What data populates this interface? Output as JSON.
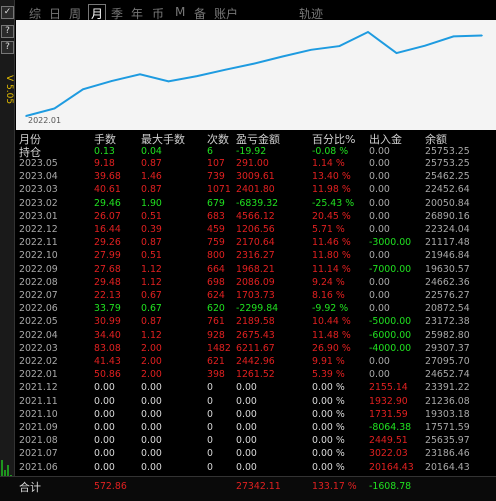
{
  "left_bar": {
    "buttons": [
      "✓",
      "?",
      "?"
    ],
    "version": "V 5.05"
  },
  "tabs": [
    "综",
    "日",
    "周",
    "月",
    "季",
    "年",
    "币",
    "M",
    "备",
    "账户",
    "轨迹"
  ],
  "active_tab": "月",
  "chart": {
    "x_label": "2022.01"
  },
  "headers": [
    "月份",
    "手数",
    "最大手数",
    "次数",
    "盈亏金额",
    "百分比%",
    "出入金",
    "余额"
  ],
  "hold": {
    "label": "持仓",
    "lots": "0.13",
    "max": "0.04",
    "count": "6",
    "pnl": "-19.92",
    "pct": "-0.08 %",
    "io": "0.00",
    "bal": "25753.25"
  },
  "rows": [
    {
      "month": "2023.05",
      "lots": "9.18",
      "max": "0.87",
      "count": "107",
      "pnl": "291.00",
      "pct": "1.14 %",
      "io": "0.00",
      "bal": "25753.25",
      "c": "red"
    },
    {
      "month": "2023.04",
      "lots": "39.68",
      "max": "1.46",
      "count": "739",
      "pnl": "3009.61",
      "pct": "13.40 %",
      "io": "0.00",
      "bal": "25462.25",
      "c": "red"
    },
    {
      "month": "2023.03",
      "lots": "40.61",
      "max": "0.87",
      "count": "1071",
      "pnl": "2401.80",
      "pct": "11.98 %",
      "io": "0.00",
      "bal": "22452.64",
      "c": "red"
    },
    {
      "month": "2023.02",
      "lots": "29.46",
      "max": "1.90",
      "count": "679",
      "pnl": "-6839.32",
      "pct": "-25.43 %",
      "io": "0.00",
      "bal": "20050.84",
      "c": "green"
    },
    {
      "month": "2023.01",
      "lots": "26.07",
      "max": "0.51",
      "count": "683",
      "pnl": "4566.12",
      "pct": "20.45 %",
      "io": "0.00",
      "bal": "26890.16",
      "c": "red"
    },
    {
      "month": "2022.12",
      "lots": "16.44",
      "max": "0.39",
      "count": "459",
      "pnl": "1206.56",
      "pct": "5.71 %",
      "io": "0.00",
      "bal": "22324.04",
      "c": "red"
    },
    {
      "month": "2022.11",
      "lots": "29.26",
      "max": "0.87",
      "count": "759",
      "pnl": "2170.64",
      "pct": "11.46 %",
      "io": "-3000.00",
      "bal": "21117.48",
      "c": "red"
    },
    {
      "month": "2022.10",
      "lots": "27.99",
      "max": "0.51",
      "count": "800",
      "pnl": "2316.27",
      "pct": "11.80 %",
      "io": "0.00",
      "bal": "21946.84",
      "c": "red"
    },
    {
      "month": "2022.09",
      "lots": "27.68",
      "max": "1.12",
      "count": "664",
      "pnl": "1968.21",
      "pct": "11.14 %",
      "io": "-7000.00",
      "bal": "19630.57",
      "c": "red"
    },
    {
      "month": "2022.08",
      "lots": "29.48",
      "max": "1.12",
      "count": "698",
      "pnl": "2086.09",
      "pct": "9.24 %",
      "io": "0.00",
      "bal": "24662.36",
      "c": "red"
    },
    {
      "month": "2022.07",
      "lots": "22.13",
      "max": "0.67",
      "count": "624",
      "pnl": "1703.73",
      "pct": "8.16 %",
      "io": "0.00",
      "bal": "22576.27",
      "c": "red"
    },
    {
      "month": "2022.06",
      "lots": "33.79",
      "max": "0.67",
      "count": "620",
      "pnl": "-2299.84",
      "pct": "-9.92 %",
      "io": "0.00",
      "bal": "20872.54",
      "c": "green"
    },
    {
      "month": "2022.05",
      "lots": "30.99",
      "max": "0.87",
      "count": "761",
      "pnl": "2189.58",
      "pct": "10.44 %",
      "io": "-5000.00",
      "bal": "23172.38",
      "c": "red"
    },
    {
      "month": "2022.04",
      "lots": "34.40",
      "max": "1.12",
      "count": "928",
      "pnl": "2675.43",
      "pct": "11.48 %",
      "io": "-6000.00",
      "bal": "25982.80",
      "c": "red"
    },
    {
      "month": "2022.03",
      "lots": "83.08",
      "max": "2.00",
      "count": "1482",
      "pnl": "6211.67",
      "pct": "26.90 %",
      "io": "-4000.00",
      "bal": "29307.37",
      "c": "red"
    },
    {
      "month": "2022.02",
      "lots": "41.43",
      "max": "2.00",
      "count": "621",
      "pnl": "2442.96",
      "pct": "9.91 %",
      "io": "0.00",
      "bal": "27095.70",
      "c": "red"
    },
    {
      "month": "2022.01",
      "lots": "50.86",
      "max": "2.00",
      "count": "398",
      "pnl": "1261.52",
      "pct": "5.39 %",
      "io": "0.00",
      "bal": "24652.74",
      "c": "red"
    },
    {
      "month": "2021.12",
      "lots": "0.00",
      "max": "0.00",
      "count": "0",
      "pnl": "0.00",
      "pct": "0.00 %",
      "io": "2155.14",
      "bal": "23391.22",
      "c": "io-red"
    },
    {
      "month": "2021.11",
      "lots": "0.00",
      "max": "0.00",
      "count": "0",
      "pnl": "0.00",
      "pct": "0.00 %",
      "io": "1932.90",
      "bal": "21236.08",
      "c": "io-red"
    },
    {
      "month": "2021.10",
      "lots": "0.00",
      "max": "0.00",
      "count": "0",
      "pnl": "0.00",
      "pct": "0.00 %",
      "io": "1731.59",
      "bal": "19303.18",
      "c": "io-red"
    },
    {
      "month": "2021.09",
      "lots": "0.00",
      "max": "0.00",
      "count": "0",
      "pnl": "0.00",
      "pct": "0.00 %",
      "io": "-8064.38",
      "bal": "17571.59",
      "c": "io-green"
    },
    {
      "month": "2021.08",
      "lots": "0.00",
      "max": "0.00",
      "count": "0",
      "pnl": "0.00",
      "pct": "0.00 %",
      "io": "2449.51",
      "bal": "25635.97",
      "c": "io-red"
    },
    {
      "month": "2021.07",
      "lots": "0.00",
      "max": "0.00",
      "count": "0",
      "pnl": "0.00",
      "pct": "0.00 %",
      "io": "3022.03",
      "bal": "23186.46",
      "c": "io-red"
    },
    {
      "month": "2021.06",
      "lots": "0.00",
      "max": "0.00",
      "count": "0",
      "pnl": "0.00",
      "pct": "0.00 %",
      "io": "20164.43",
      "bal": "20164.43",
      "c": "io-red"
    }
  ],
  "total": {
    "label": "合计",
    "lots": "572.86",
    "pnl": "27342.11",
    "pct": "133.17 %",
    "io": "-1608.78"
  },
  "chart_data": {
    "type": "line",
    "x": [
      "2022.01",
      "2022.02",
      "2022.03",
      "2022.04",
      "2022.05",
      "2022.06",
      "2022.07",
      "2022.08",
      "2022.09",
      "2022.10",
      "2022.11",
      "2022.12",
      "2023.01",
      "2023.02",
      "2023.03",
      "2023.04",
      "2023.05"
    ],
    "series": [
      {
        "values": [
          1261.52,
          3704.48,
          9916.15,
          12591.58,
          14781.16,
          12481.32,
          14185.05,
          16271.14,
          18239.35,
          20555.62,
          22726.26,
          23932.82,
          28498.94,
          21659.62,
          24061.42,
          27071.03,
          27362.03
        ]
      }
    ],
    "color": "#1e9be0"
  }
}
